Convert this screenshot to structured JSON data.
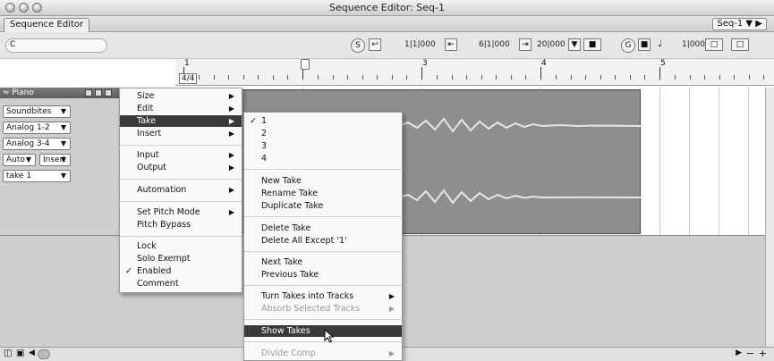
{
  "window": {
    "title": "Sequence Editor: Seq-1"
  },
  "toolbar": {
    "tab_label": "Sequence Editor",
    "seq_menu": "Seq-1 ▼"
  },
  "transport": {
    "search_letter": "C",
    "position": "1|1|000",
    "end": "6|1|000",
    "length": "20|000",
    "grid_value": "1|000"
  },
  "ruler": {
    "bars": [
      "1",
      "2",
      "3",
      "4",
      "5"
    ],
    "time_signature": "4/4"
  },
  "track": {
    "name": "≈ Piano",
    "input": "Soundbites",
    "output1": "Analog 1-2",
    "output2": "Analog 3-4",
    "mode": "Auto",
    "insert": "Insert",
    "take": "take 1"
  },
  "context_menu": {
    "items": [
      {
        "label": "Size",
        "sub": "▶"
      },
      {
        "label": "Edit",
        "sub": "▶"
      },
      {
        "label": "Take",
        "sub": "▶"
      },
      {
        "label": "Insert",
        "sub": "▶"
      },
      {
        "label": "Input",
        "sub": "▶"
      },
      {
        "label": "Output",
        "sub": "▶"
      },
      {
        "label": "Automation",
        "sub": "▶"
      },
      {
        "label": "Set Pitch Mode",
        "sub": "▶"
      },
      {
        "label": "Pitch Bypass"
      },
      {
        "label": "Lock"
      },
      {
        "label": "Solo Exempt"
      },
      {
        "label": "Enabled",
        "check": "✓"
      },
      {
        "label": "Comment"
      }
    ]
  },
  "take_submenu": {
    "takes": [
      "1",
      "2",
      "3",
      "4"
    ],
    "checked_mark": "✓",
    "items": [
      "New Take",
      "Rename Take",
      "Duplicate Take",
      "Delete Take",
      "Delete All Except '1'",
      "Next Take",
      "Previous Take",
      "Turn Takes into Tracks",
      "Absorb Selected Tracks",
      "Show Takes",
      "Divide Comp"
    ],
    "arrow": "▶"
  }
}
